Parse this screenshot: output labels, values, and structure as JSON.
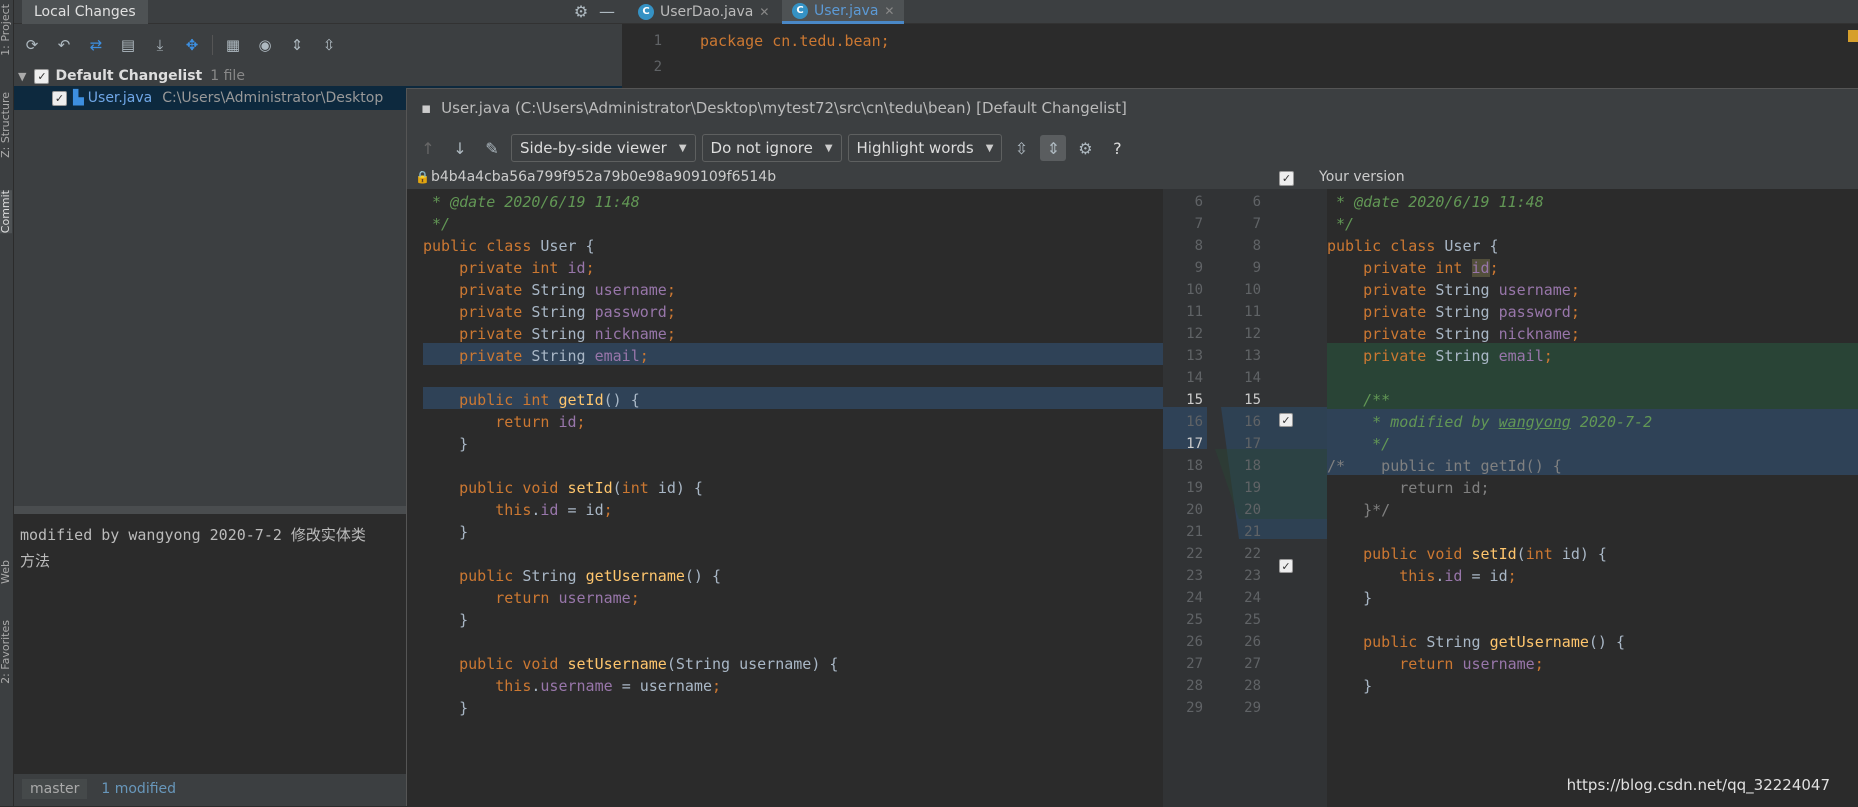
{
  "stripe": {
    "tabs": [
      "1: Project",
      "Z: Structure",
      "Commit",
      "Web",
      "2: Favorites"
    ]
  },
  "commit_panel": {
    "tab_label": "Local Changes",
    "toolbar_icons": [
      "refresh-icon",
      "rollback-icon",
      "show-diff-icon",
      "shelve-icon",
      "update-icon",
      "expand-icon",
      "group-icon",
      "eye-icon",
      "expand-all-icon",
      "collapse-all-icon"
    ],
    "changelist": {
      "name": "Default Changelist",
      "count": "1 file"
    },
    "file": {
      "name": "User.java",
      "path": "C:\\Users\\Administrator\\Desktop"
    },
    "message_line1": "modified by wangyong 2020-7-2 修改实体类",
    "message_underlined": "wangyong",
    "message_line2": "方法",
    "branch": "master",
    "modified": "1 modified"
  },
  "editor_tabs": [
    {
      "label": "UserDao.java",
      "active": false
    },
    {
      "label": "User.java",
      "active": true
    }
  ],
  "bg_editor": {
    "line1": "1",
    "line2": "2",
    "code": "package cn.tedu.bean;"
  },
  "diff": {
    "title": "User.java (C:\\Users\\Administrator\\Desktop\\mytest72\\src\\cn\\tedu\\bean) [Default Changelist]",
    "viewer": "Side-by-side viewer",
    "ignore": "Do not ignore",
    "highlight": "Highlight words",
    "help": "?",
    "left_header": "b4b4a4cba56a799f952a79b0e98a909109f6514b",
    "right_header": "Your version",
    "left_lines": [
      "6",
      "7",
      "8",
      "9",
      "10",
      "11",
      "12",
      "13",
      "14",
      "15",
      "16",
      "17",
      "18",
      "19",
      "20",
      "21",
      "22",
      "23",
      "24",
      "25",
      "26",
      "27",
      "28",
      "29"
    ],
    "right_lines": [
      "6",
      "7",
      "8",
      "9",
      "10",
      "11",
      "12",
      "13",
      "14",
      "15",
      "16",
      "17",
      "18",
      "19",
      "20",
      "21",
      "22",
      "23",
      "24",
      "25",
      "26",
      "27",
      "28",
      "29"
    ],
    "colors": {
      "changed_bg": "#2f4257",
      "added_bg": "#294436",
      "keyword": "#cc7832",
      "field": "#9876aa",
      "function": "#ffc66d",
      "comment": "#629755"
    }
  },
  "watermark": "https://blog.csdn.net/qq_32224047"
}
